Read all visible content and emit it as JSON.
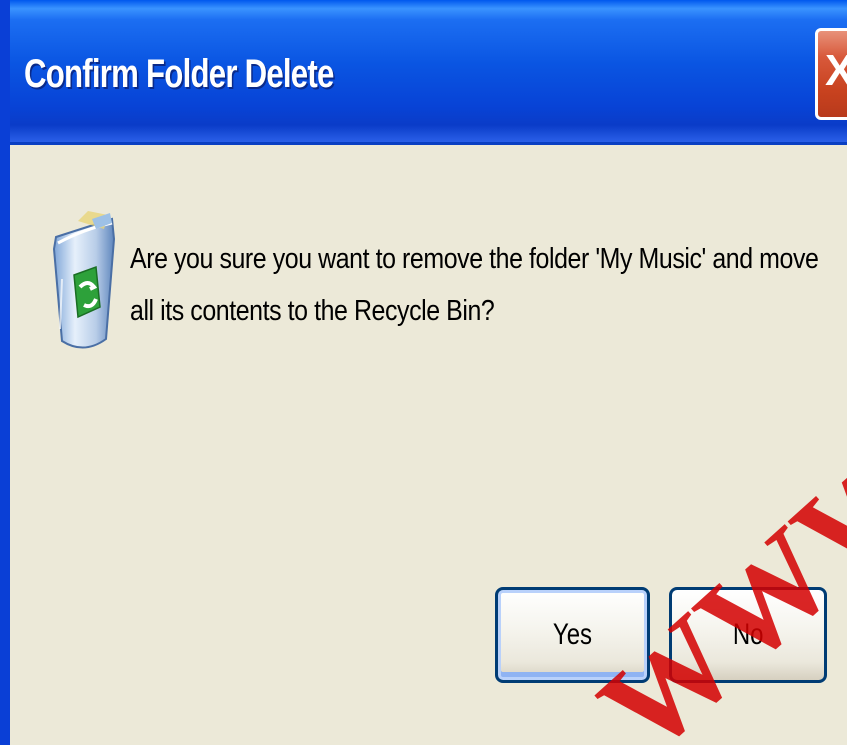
{
  "window": {
    "title": "Confirm Folder Delete",
    "close_label": "X"
  },
  "dialog": {
    "icon": "recycle-bin-icon",
    "message": "Are you sure you want to remove the folder 'My Music' and move all its contents to the Recycle Bin?"
  },
  "buttons": {
    "yes_label": "Yes",
    "no_label": "No",
    "default": "Yes"
  },
  "watermark": {
    "text": "WWW*PN"
  },
  "colors": {
    "titlebar": "#0a55e2",
    "dialog_bg": "#ece9d8",
    "close_button": "#c8421f",
    "button_border": "#003c74",
    "watermark": "#d40000"
  }
}
